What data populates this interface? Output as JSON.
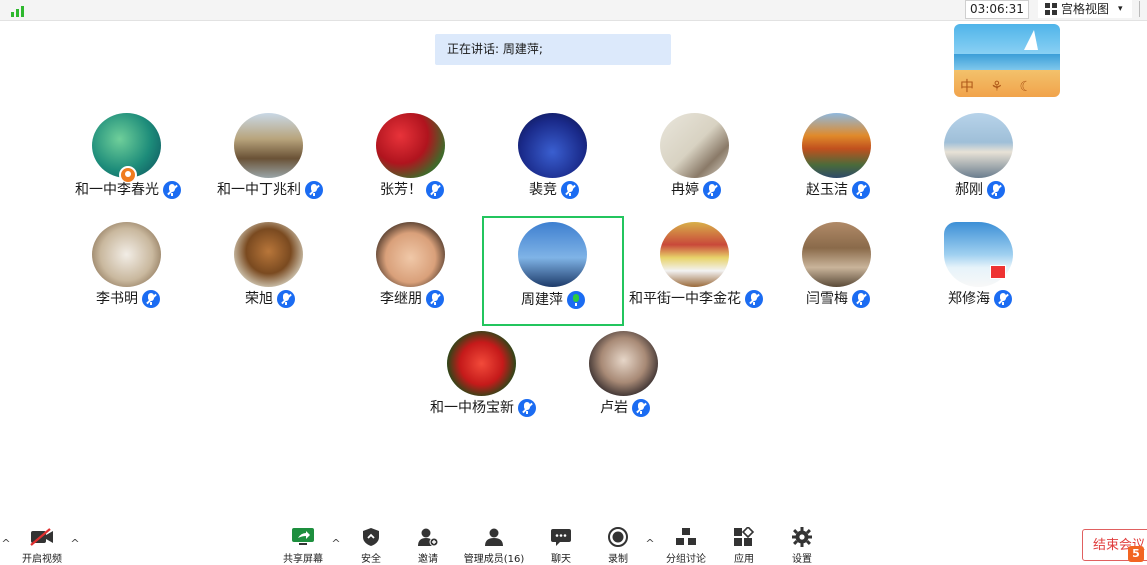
{
  "topbar": {
    "timer": "03:06:31",
    "view_label": "宫格视图",
    "view_caret": "▾"
  },
  "speaking_banner": "正在讲话: 周建萍;",
  "self_view": {
    "text": "中 ⚘ ☾ ♖"
  },
  "participants": [
    {
      "name": "和一中李春光",
      "mic": "muted"
    },
    {
      "name": "和一中丁兆利",
      "mic": "muted"
    },
    {
      "name": "张芳！",
      "mic": "muted"
    },
    {
      "name": "裴竞",
      "mic": "muted"
    },
    {
      "name": "冉婷",
      "mic": "muted"
    },
    {
      "name": "赵玉洁",
      "mic": "muted"
    },
    {
      "name": "郝刚",
      "mic": "muted"
    },
    {
      "name": "李书明",
      "mic": "muted"
    },
    {
      "name": "荣旭",
      "mic": "muted"
    },
    {
      "name": "李继朋",
      "mic": "muted"
    },
    {
      "name": "周建萍",
      "mic": "active"
    },
    {
      "name": "和平街一中李金花",
      "mic": "muted"
    },
    {
      "name": "闫雪梅",
      "mic": "muted"
    },
    {
      "name": "郑修海",
      "mic": "muted"
    },
    {
      "name": "和一中杨宝新",
      "mic": "muted"
    },
    {
      "name": "卢岩",
      "mic": "muted"
    }
  ],
  "toolbar": {
    "video": "开启视频",
    "share": "共享屏幕",
    "security": "安全",
    "invite": "邀请",
    "participants": "管理成员(16)",
    "chat": "聊天",
    "record": "录制",
    "breakout": "分组讨论",
    "apps": "应用",
    "settings": "设置",
    "end": "结束会议",
    "end_badge": "5"
  },
  "colors": {
    "accent_blue": "#1b6cf2",
    "speaking_bg": "#dce9fb",
    "active_border": "#23c55e",
    "end_red": "#e03c3c"
  }
}
